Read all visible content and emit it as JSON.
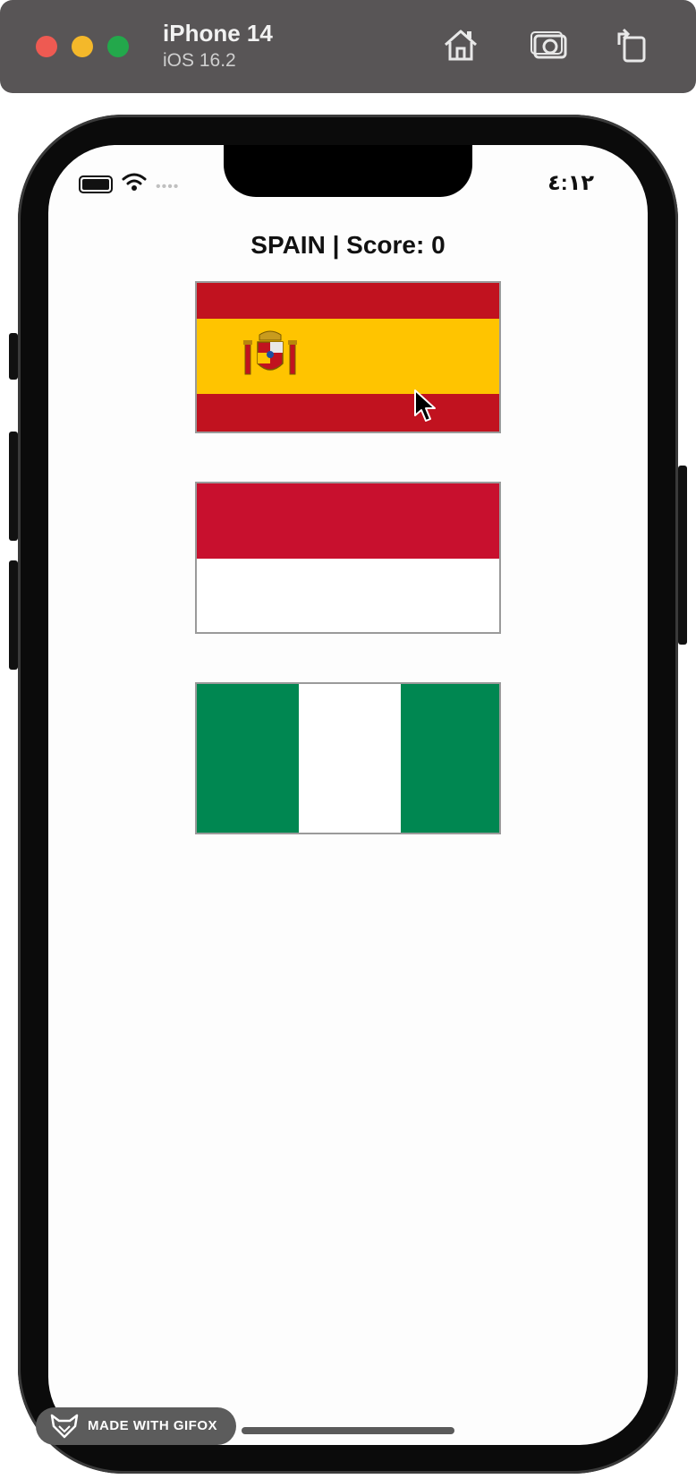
{
  "window": {
    "device_name": "iPhone 14",
    "os_version": "iOS 16.2",
    "toolbar_icons": [
      "home-icon",
      "screenshot-icon",
      "rotate-icon"
    ]
  },
  "status_bar": {
    "time": "٤:١٢",
    "icons": [
      "battery-icon",
      "wifi-icon",
      "signal-dots-icon"
    ]
  },
  "game": {
    "title": "SPAIN | Score: 0",
    "flags": [
      {
        "country": "spain",
        "colors": [
          "#c1121f",
          "#ffc400",
          "#c1121f"
        ]
      },
      {
        "country": "monaco-indonesia",
        "colors": [
          "#c8102e",
          "#ffffff"
        ]
      },
      {
        "country": "nigeria",
        "colors": [
          "#008751",
          "#ffffff",
          "#008751"
        ]
      }
    ]
  },
  "watermark": {
    "text": "MADE WITH GIFOX"
  }
}
